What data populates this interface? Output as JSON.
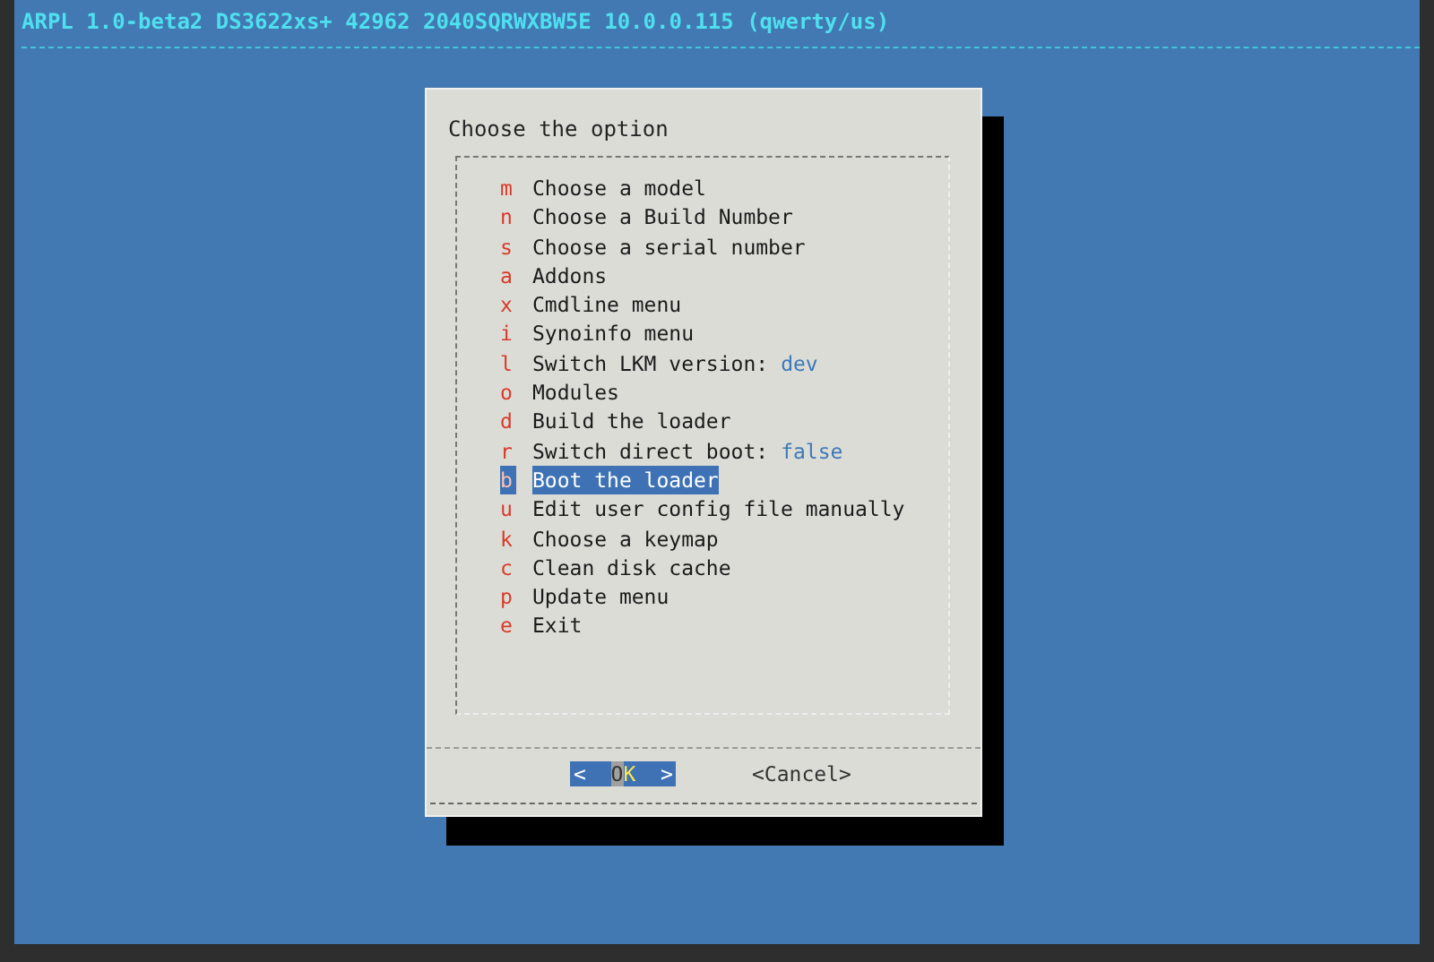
{
  "header": {
    "title": "ARPL 1.0-beta2 DS3622xs+ 42962 2040SQRWXBW5E 10.0.0.115 (qwerty/us)"
  },
  "dialog": {
    "title": "Choose the option",
    "items": [
      {
        "key": "m",
        "label": "Choose a model",
        "selected": false
      },
      {
        "key": "n",
        "label": "Choose a Build Number",
        "selected": false
      },
      {
        "key": "s",
        "label": "Choose a serial number",
        "selected": false
      },
      {
        "key": "a",
        "label": "Addons",
        "selected": false
      },
      {
        "key": "x",
        "label": "Cmdline menu",
        "selected": false
      },
      {
        "key": "i",
        "label": "Synoinfo menu",
        "selected": false
      },
      {
        "key": "l",
        "label": "Switch LKM version:",
        "value": "dev",
        "selected": false
      },
      {
        "key": "o",
        "label": "Modules",
        "selected": false
      },
      {
        "key": "d",
        "label": "Build the loader",
        "selected": false
      },
      {
        "key": "r",
        "label": "Switch direct boot:",
        "value": "false",
        "selected": false
      },
      {
        "key": "b",
        "label": "Boot the loader",
        "selected": true
      },
      {
        "key": "u",
        "label": "Edit user config file manually",
        "selected": false
      },
      {
        "key": "k",
        "label": "Choose a keymap",
        "selected": false
      },
      {
        "key": "c",
        "label": "Clean disk cache",
        "selected": false
      },
      {
        "key": "p",
        "label": "Update menu",
        "selected": false
      },
      {
        "key": "e",
        "label": "Exit",
        "selected": false
      }
    ],
    "buttons": [
      {
        "open": "<",
        "label": "OK",
        "close": ">",
        "selected": true
      },
      {
        "open": "<",
        "label": "Cancel",
        "close": ">",
        "selected": false
      }
    ]
  }
}
